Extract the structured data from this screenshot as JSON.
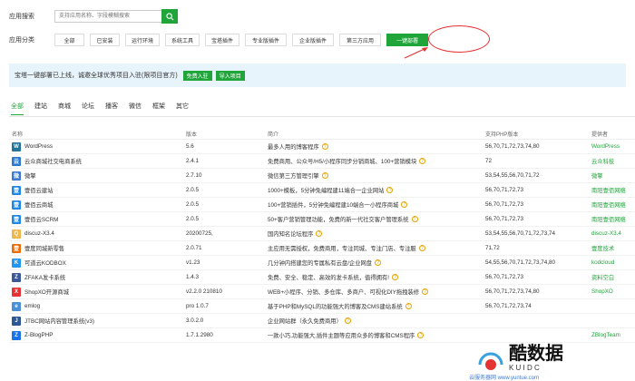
{
  "search": {
    "label": "应用搜索",
    "placeholder": "支持应用名称、字段模糊搜索"
  },
  "category": {
    "label": "应用分类",
    "items": [
      "全部",
      "已安装",
      "运行环境",
      "系统工具",
      "宝塔插件",
      "专业版插件",
      "企业版插件",
      "第三方应用",
      "一键部署"
    ],
    "active_index": 8
  },
  "banner": {
    "text": "宝塔一键部署已上线，诚邀全球优秀项目入驻(限项目官方)",
    "btn_free": "免费入驻",
    "btn_import": "导入项目"
  },
  "tabs": {
    "items": [
      "全部",
      "建站",
      "商城",
      "论坛",
      "播客",
      "微信",
      "框架",
      "其它"
    ],
    "active_index": 0
  },
  "table": {
    "headers": [
      "名称",
      "版本",
      "简介",
      "支持PHP版本",
      "提供者"
    ],
    "rows": [
      {
        "name": "WordPress",
        "ver": "5.6",
        "desc": "最多人用的博客程序",
        "php": "56,70,71,72,73,74,80",
        "prov": "WordPress",
        "icon": "wordpress-icon",
        "color": "#21759b",
        "glyph": "W"
      },
      {
        "name": "云众商城社交电商系统",
        "ver": "2.4.1",
        "desc": "免费商用、公众号/H5/小程序同步分销商城、100+营销模块",
        "php": "72",
        "prov": "云众科技",
        "icon": "yunzhong-icon",
        "color": "#2a79d3",
        "glyph": "云"
      },
      {
        "name": "微擎",
        "ver": "2.7.10",
        "desc": "微信第三方管理引擎",
        "php": "53,54,55,56,70,71,72",
        "prov": "微擎",
        "icon": "weiqing-icon",
        "color": "#3a7bd5",
        "glyph": "微"
      },
      {
        "name": "壹佰云建站",
        "ver": "2.0.5",
        "desc": "1000+模板，5分钟免编程建11端合一企业网站",
        "php": "56,70,71,72,73",
        "prov": "南阳壹佰网络",
        "icon": "yibai-site-icon",
        "color": "#1e88e5",
        "glyph": "壹"
      },
      {
        "name": "壹佰云商城",
        "ver": "2.0.5",
        "desc": "100+营销插件，5分钟免编程建10端合一小程序商城",
        "php": "56,70,71,72,73",
        "prov": "南阳壹佰网络",
        "icon": "yibai-mall-icon",
        "color": "#1e88e5",
        "glyph": "壹"
      },
      {
        "name": "壹佰云SCRM",
        "ver": "2.0.5",
        "desc": "50+客户营销管理功能，免费的新一代社交客户管理系统",
        "php": "56,70,71,72,73",
        "prov": "南阳壹佰网络",
        "icon": "yibai-scrm-icon",
        "color": "#1e88e5",
        "glyph": "壹"
      },
      {
        "name": "discuz-X3.4",
        "ver": "20200725,",
        "desc": "国内知名论坛程序",
        "php": "53,54,55,56,70,71,72,73,74",
        "prov": "discuz-X3.4",
        "icon": "discuz-icon",
        "color": "#f0b64b",
        "glyph": "Q"
      },
      {
        "name": "壹度同城新零售",
        "ver": "2.0.71",
        "desc": "主应用无需授权，免费商用，专注同城、专注门店、专注服",
        "php": "71,72",
        "prov": "壹度技术",
        "icon": "yidu-icon",
        "color": "#ef6c00",
        "glyph": "壹"
      },
      {
        "name": "可道云KODBOX",
        "ver": "v1.23",
        "desc": "几分钟内搭建您的专属私有云盘/企业网盘",
        "php": "54,55,56,70,71,72,73,74,80",
        "prov": "kodcloud",
        "icon": "kodbox-icon",
        "color": "#2196f3",
        "glyph": "K"
      },
      {
        "name": "ZFAKA发卡系统",
        "ver": "1.4.3",
        "desc": "免费、安全、稳定、高效的发卡系统，值得拥有!",
        "php": "56,70,71,72,73",
        "prov": "资料空白",
        "icon": "zfaka-icon",
        "color": "#3b5998",
        "glyph": "Z"
      },
      {
        "name": "ShopXO开源商城",
        "ver": "v2.2.0 210810",
        "desc": "WEB+小程序、分销、多仓库、多商户、可视化DIY拖拽装修",
        "php": "56,70,71,72,73,74,80",
        "prov": "ShopXO",
        "icon": "shopxo-icon",
        "color": "#e53333",
        "glyph": "X"
      },
      {
        "name": "emlog",
        "ver": "pro 1.0.7",
        "desc": "基于PHP和MySQL的功能强大的博客及CMS建站系统",
        "php": "56,70,71,72,73,74",
        "prov": "",
        "icon": "emlog-icon",
        "color": "#4a90d9",
        "glyph": "e"
      },
      {
        "name": "JTBC网站内容管理系统(v3)",
        "ver": "3.0.2.0",
        "desc": "企业网站群（永久免费商用）",
        "php": "",
        "prov": "",
        "icon": "jtbc-icon",
        "color": "#2b5797",
        "glyph": "J"
      },
      {
        "name": "Z-BlogPHP",
        "ver": "1.7.1.2980",
        "desc": "一款小巧,功能强大,插件主题等应用众多的博客和CMS程序",
        "php": "",
        "prov": "ZBlogTeam",
        "icon": "zblog-icon",
        "color": "#1a73e8",
        "glyph": "Z"
      }
    ]
  },
  "watermark": {
    "big": "酷数据",
    "mid": "K U I D C",
    "small": "云服务器网 www.yuntue.com"
  }
}
